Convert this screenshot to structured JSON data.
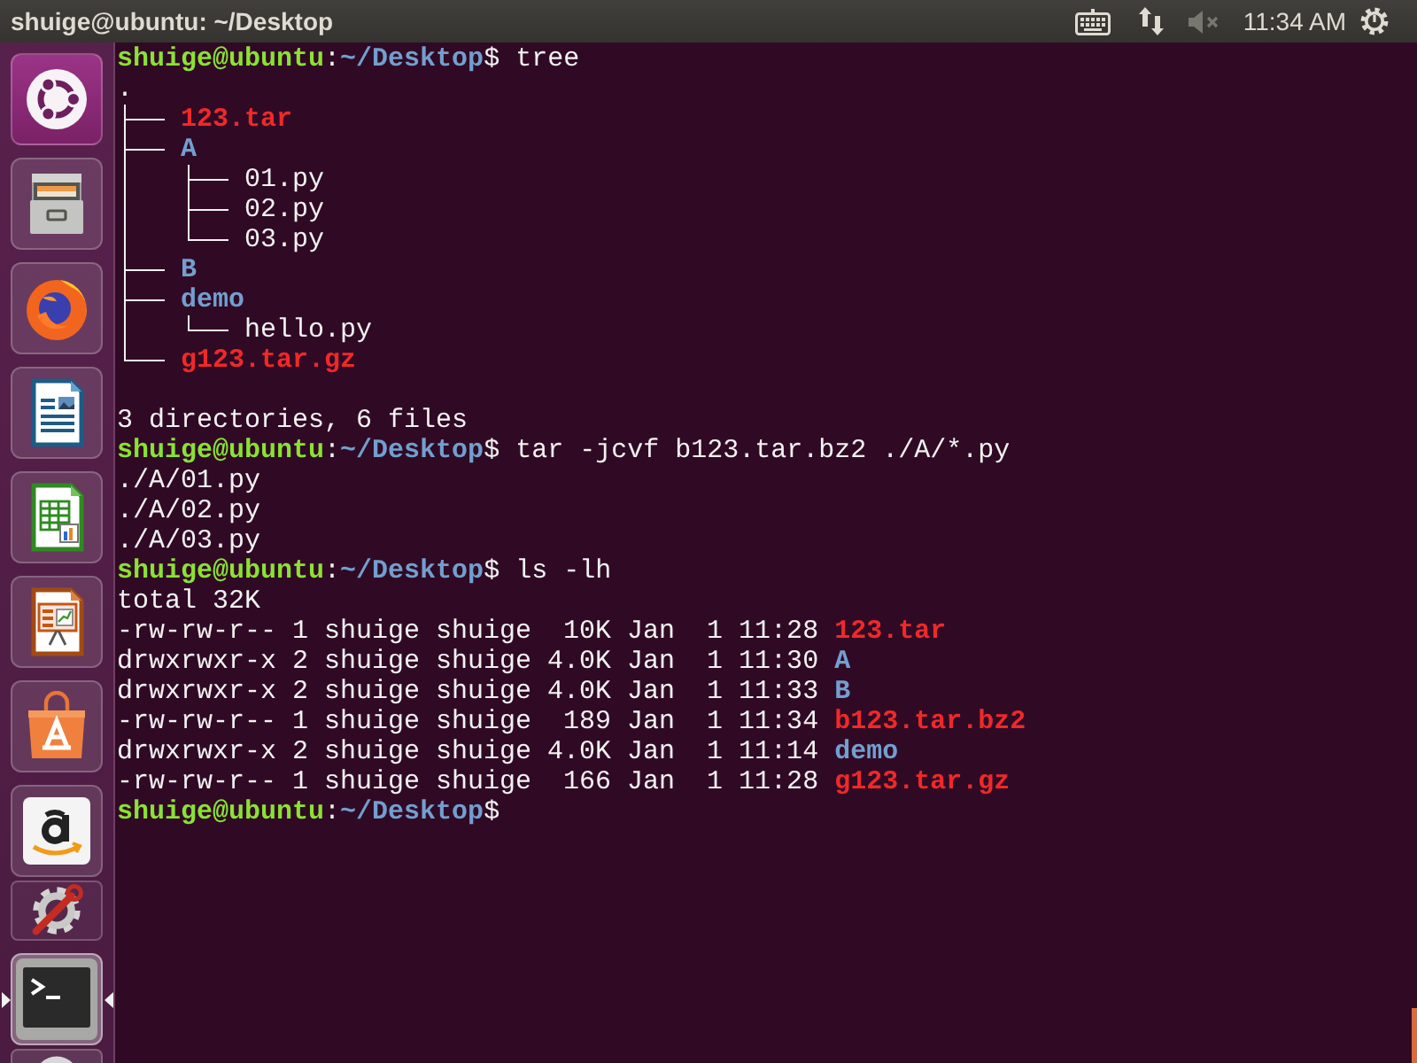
{
  "top_bar": {
    "title": "shuige@ubuntu: ~/Desktop",
    "indicators": [
      {
        "kind": "keyboard"
      },
      {
        "kind": "network"
      },
      {
        "kind": "sound",
        "muted": true
      },
      {
        "kind": "clock",
        "text": "11:34 AM"
      },
      {
        "kind": "session"
      }
    ]
  },
  "launcher": {
    "items": [
      {
        "kind": "dash",
        "running": false,
        "focused": false,
        "folded": false
      },
      {
        "kind": "files",
        "running": false,
        "focused": false,
        "folded": false
      },
      {
        "kind": "browser",
        "running": false,
        "focused": false,
        "folded": false
      },
      {
        "kind": "writer",
        "running": false,
        "focused": false,
        "folded": false
      },
      {
        "kind": "calc",
        "running": false,
        "focused": false,
        "folded": false
      },
      {
        "kind": "impress",
        "running": false,
        "focused": false,
        "folded": false
      },
      {
        "kind": "software",
        "running": false,
        "focused": false,
        "folded": false
      },
      {
        "kind": "shopping",
        "running": false,
        "focused": false,
        "folded": false
      },
      {
        "kind": "settings",
        "running": false,
        "focused": false,
        "folded": true
      },
      {
        "kind": "terminal",
        "running": true,
        "focused": true,
        "folded": false
      },
      {
        "kind": "disc",
        "running": false,
        "focused": false,
        "folded": true
      }
    ]
  },
  "terminal": {
    "lines": [
      {
        "kind": "prompt",
        "user": "shuige@ubuntu",
        "separator": ":",
        "path": "~/Desktop",
        "symbol": "$",
        "command": "tree"
      },
      {
        "kind": "tree",
        "root": ".",
        "children": [
          {
            "name": "123.tar",
            "kind": "archive"
          },
          {
            "name": "A",
            "kind": "dir",
            "children": [
              {
                "name": "01.py",
                "kind": "file"
              },
              {
                "name": "02.py",
                "kind": "file"
              },
              {
                "name": "03.py",
                "kind": "file"
              }
            ]
          },
          {
            "name": "B",
            "kind": "dir"
          },
          {
            "name": "demo",
            "kind": "dir",
            "children": [
              {
                "name": "hello.py",
                "kind": "file"
              }
            ]
          },
          {
            "name": "g123.tar.gz",
            "kind": "archive"
          }
        ]
      },
      {
        "kind": "blank"
      },
      {
        "kind": "output",
        "text": "3 directories, 6 files"
      },
      {
        "kind": "prompt",
        "user": "shuige@ubuntu",
        "separator": ":",
        "path": "~/Desktop",
        "symbol": "$",
        "command": "tar -jcvf b123.tar.bz2 ./A/*.py"
      },
      {
        "kind": "output",
        "text": "./A/01.py"
      },
      {
        "kind": "output",
        "text": "./A/02.py"
      },
      {
        "kind": "output",
        "text": "./A/03.py"
      },
      {
        "kind": "prompt",
        "user": "shuige@ubuntu",
        "separator": ":",
        "path": "~/Desktop",
        "symbol": "$",
        "command": "ls -lh"
      },
      {
        "kind": "output",
        "text": "total 32K"
      },
      {
        "kind": "listing",
        "details": "-rw-rw-r-- 1 shuige shuige  10K Jan  1 11:28",
        "entry": {
          "name": "123.tar",
          "kind": "archive"
        }
      },
      {
        "kind": "listing",
        "details": "drwxrwxr-x 2 shuige shuige 4.0K Jan  1 11:30",
        "entry": {
          "name": "A",
          "kind": "dir"
        }
      },
      {
        "kind": "listing",
        "details": "drwxrwxr-x 2 shuige shuige 4.0K Jan  1 11:33",
        "entry": {
          "name": "B",
          "kind": "dir"
        }
      },
      {
        "kind": "listing",
        "details": "-rw-rw-r-- 1 shuige shuige  189 Jan  1 11:34",
        "entry": {
          "name": "b123.tar.bz2",
          "kind": "archive"
        }
      },
      {
        "kind": "listing",
        "details": "drwxrwxr-x 2 shuige shuige 4.0K Jan  1 11:14",
        "entry": {
          "name": "demo",
          "kind": "dir"
        }
      },
      {
        "kind": "listing",
        "details": "-rw-rw-r-- 1 shuige shuige  166 Jan  1 11:28",
        "entry": {
          "name": "g123.tar.gz",
          "kind": "archive"
        }
      },
      {
        "kind": "prompt",
        "user": "shuige@ubuntu",
        "separator": ":",
        "path": "~/Desktop",
        "symbol": "$"
      }
    ]
  }
}
